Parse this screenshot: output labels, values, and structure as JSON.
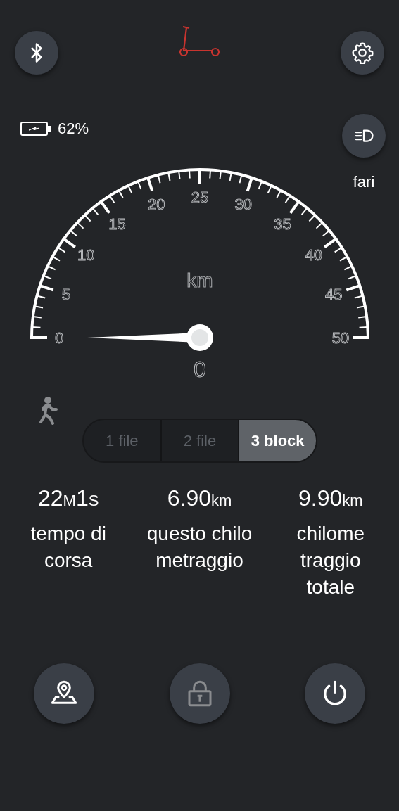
{
  "top_bar": {
    "buttons": [
      {
        "kind": "bluetooth"
      },
      {
        "kind": "settings"
      }
    ]
  },
  "battery": {
    "reading": "62%"
  },
  "headlight": {
    "label": "fari",
    "on": false
  },
  "gauge": {
    "unit": "km",
    "reading": "0",
    "ticks": [
      "0",
      "5",
      "10",
      "15",
      "20",
      "25",
      "30",
      "35",
      "40",
      "45",
      "50"
    ]
  },
  "modes": [
    {
      "label": "1 file",
      "selected": false
    },
    {
      "label": "2 file",
      "selected": false
    },
    {
      "label": "3 block",
      "selected": true
    }
  ],
  "stats": [
    {
      "value": [
        {
          "kind": "number",
          "text": "22"
        },
        {
          "kind": "unit",
          "text": "M"
        },
        {
          "kind": "number",
          "text": "1"
        },
        {
          "kind": "unit",
          "text": "S"
        }
      ],
      "label": "tempo di corsa"
    },
    {
      "value": [
        {
          "kind": "number",
          "text": "6.90"
        },
        {
          "kind": "unit",
          "text": "km"
        }
      ],
      "label": "questo chilo metraggio"
    },
    {
      "value": [
        {
          "kind": "number",
          "text": "9.90"
        },
        {
          "kind": "unit",
          "text": "km"
        }
      ],
      "label": "chilome traggio totale"
    }
  ],
  "bottom_buttons": [
    {
      "kind": "map",
      "disabled": false
    },
    {
      "kind": "lock",
      "disabled": true
    },
    {
      "kind": "power",
      "disabled": false
    }
  ]
}
